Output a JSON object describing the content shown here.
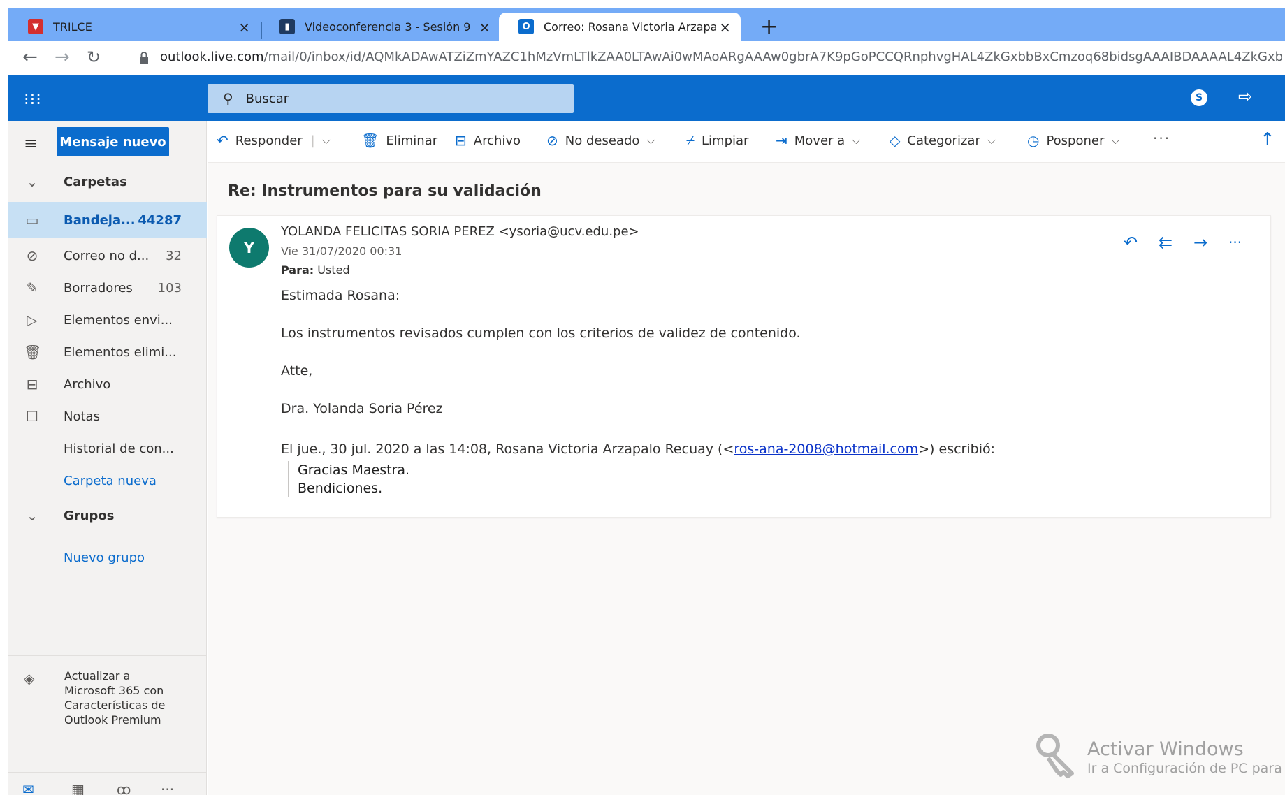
{
  "browser": {
    "tabs": [
      {
        "title": "TRILCE",
        "favicon": "trilce-icon",
        "color": "#d32f2f"
      },
      {
        "title": "Videoconferencia 3 - Sesión 9",
        "favicon": "course-icon",
        "color": "#1f3a60"
      },
      {
        "title": "Correo: Rosana Victoria Arzapalo",
        "favicon": "outlook-icon",
        "color": "#0b6ccd"
      }
    ],
    "url_host": "outlook.live.com",
    "url_path": "/mail/0/inbox/id/AQMkADAwATZiZmYAZC1hMzVmLTlkZAA0LTAwAi0wMAoARgAAAw0gbrA7K9pGoPCCQRnphvgHAL4ZkGxbbBxCmzoq68bidsgAAAIBDAAAAL4ZkGxb"
  },
  "header": {
    "search_placeholder": "Buscar",
    "skype_letter": "S"
  },
  "sidebar": {
    "new_message": "Mensaje nuevo",
    "folders_header": "Carpetas",
    "items": [
      {
        "label": "Bandeja...",
        "count": "44287",
        "icon": "inbox-icon"
      },
      {
        "label": "Correo no d...",
        "count": "32",
        "icon": "junk-icon"
      },
      {
        "label": "Borradores",
        "count": "103",
        "icon": "drafts-icon"
      },
      {
        "label": "Elementos envi...",
        "count": "",
        "icon": "sent-icon"
      },
      {
        "label": "Elementos elimi...",
        "count": "",
        "icon": "deleted-icon"
      },
      {
        "label": "Archivo",
        "count": "",
        "icon": "archive-icon"
      },
      {
        "label": "Notas",
        "count": "",
        "icon": "notes-icon"
      },
      {
        "label": "Historial de con...",
        "count": "",
        "icon": ""
      }
    ],
    "new_folder": "Carpeta nueva",
    "groups_header": "Grupos",
    "new_group": "Nuevo grupo",
    "upsell": "Actualizar a Microsoft 365 con Características de Outlook Premium"
  },
  "toolbar": {
    "reply": "Responder",
    "delete": "Eliminar",
    "archive": "Archivo",
    "junk": "No deseado",
    "sweep": "Limpiar",
    "move": "Mover a",
    "categorize": "Categorizar",
    "snooze": "Posponer"
  },
  "message": {
    "subject": "Re: Instrumentos para su validación",
    "avatar_letter": "Y",
    "from": "YOLANDA FELICITAS SORIA PEREZ <ysoria@ucv.edu.pe>",
    "date": "Vie 31/07/2020 00:31",
    "to_label": "Para:",
    "to_value": "Usted",
    "body_lines": [
      "Estimada Rosana:",
      "Los instrumentos revisados cumplen con los criterios de validez de contenido.",
      "Atte,",
      "Dra. Yolanda Soria Pérez"
    ],
    "quote_prefix": "El jue., 30 jul. 2020 a las 14:08, Rosana Victoria Arzapalo Recuay (<",
    "quote_email": "ros-ana-2008@hotmail.com",
    "quote_suffix": ">) escribió:",
    "quote_lines": [
      "Gracias Maestra.",
      "Bendiciones."
    ]
  },
  "watermark": {
    "title": "Activar Windows",
    "subtitle": "Ir a Configuración de PC para"
  }
}
